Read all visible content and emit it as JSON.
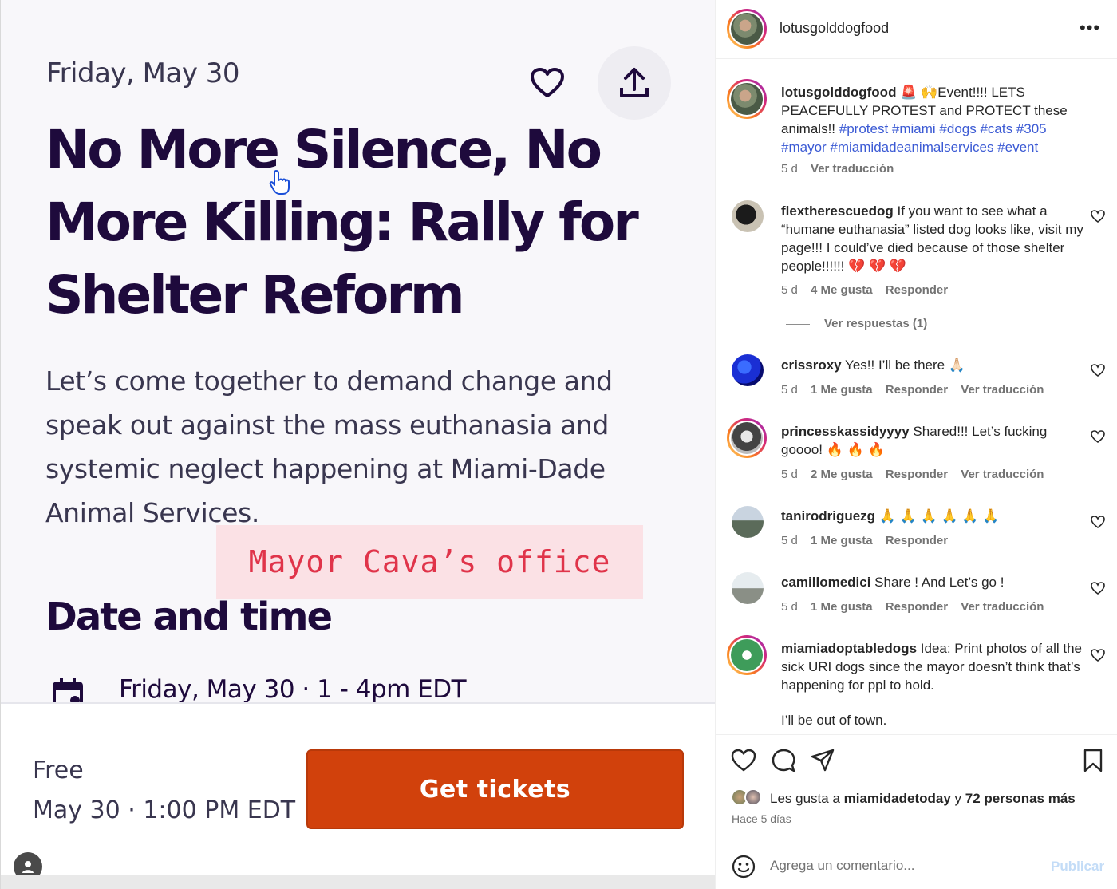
{
  "event": {
    "date": "Friday, May 30",
    "title": "No More Silence, No More Killing: Rally for Shelter Reform",
    "description": "Let’s come together to demand change and speak out against the mass euthanasia and systemic neglect happening at Miami-Dade Animal Services.",
    "overlay_text": "Mayor Cava’s office",
    "date_time_heading": "Date and time",
    "date_time_line": "Friday, May 30 · 1 - 4pm EDT",
    "ticket_price": "Free",
    "ticket_when": "May 30 · 1:00 PM EDT",
    "ticket_button": "Get tickets"
  },
  "post": {
    "username": "lotusgolddogfood",
    "caption": {
      "user": "lotusgolddogfood",
      "text": "🚨 🙌Event!!!! LETS PEACEFULLY PROTEST and PROTECT these animals!!",
      "tags": "#protest #miami #dogs #cats #305 #mayor #miamidadeanimalservices #event",
      "time": "5 d",
      "translate": "Ver traducción"
    },
    "comments": [
      {
        "user": "flextherescuedog",
        "text": "If you want to see what a “humane euthanasia” listed dog looks like, visit my page!!! I could’ve died because of those shelter people!!!!!! 💔 💔 💔",
        "time": "5 d",
        "likes": "4 Me gusta",
        "reply": "Responder",
        "translate": ""
      },
      {
        "user": "crissroxy",
        "text": "Yes!! I’ll be there 🙏🏻",
        "time": "5 d",
        "likes": "1 Me gusta",
        "reply": "Responder",
        "translate": "Ver traducción"
      },
      {
        "user": "princesskassidyyyy",
        "text": "Shared!!! Let’s fucking goooo! 🔥 🔥 🔥",
        "time": "5 d",
        "likes": "2 Me gusta",
        "reply": "Responder",
        "translate": "Ver traducción"
      },
      {
        "user": "tanirodriguezg",
        "text": "🙏 🙏 🙏 🙏 🙏 🙏",
        "time": "5 d",
        "likes": "1 Me gusta",
        "reply": "Responder",
        "translate": ""
      },
      {
        "user": "camillomedici",
        "text": "Share ! And Let’s go !",
        "time": "5 d",
        "likes": "1 Me gusta",
        "reply": "Responder",
        "translate": "Ver traducción"
      },
      {
        "user": "miamiadoptabledogs",
        "text": "Idea: Print photos of all the sick URI dogs since the mayor doesn’t think that’s happening for ppl to hold.",
        "text2": "I’ll be out of town."
      }
    ],
    "view_replies": "Ver respuestas (1)",
    "likes_prefix": "Les gusta a",
    "likes_user": "miamidadetoday",
    "likes_connector": "y",
    "likes_rest": "72 personas más",
    "posted_ago": "Hace 5 días",
    "comment_placeholder": "Agrega un comentario...",
    "publish_label": "Publicar",
    "colors": {
      "accent": "#d1410c",
      "link": "#3b5ad4",
      "title": "#1e0a3c",
      "overlay": "#e0344a"
    }
  }
}
